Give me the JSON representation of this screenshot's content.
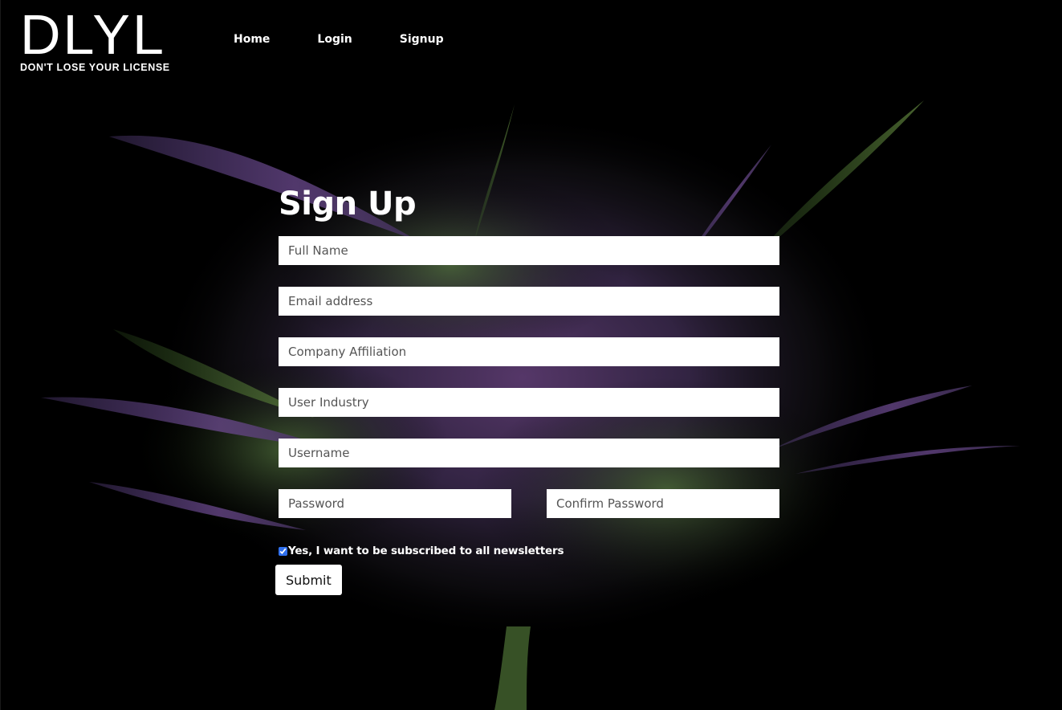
{
  "brand": {
    "logo_text": "DLYL",
    "tagline": "DON'T LOSE YOUR LICENSE"
  },
  "nav": {
    "items": [
      {
        "label": "Home"
      },
      {
        "label": "Login"
      },
      {
        "label": "Signup"
      }
    ]
  },
  "form": {
    "title": "Sign Up",
    "full_name_placeholder": "Full Name",
    "email_placeholder": "Email address",
    "company_placeholder": "Company Affiliation",
    "industry_placeholder": "User Industry",
    "username_placeholder": "Username",
    "password_placeholder": "Password",
    "confirm_password_placeholder": "Confirm Password",
    "newsletter_label": "Yes, I want to be subscribed to all newsletters",
    "newsletter_checked": true,
    "submit_label": "Submit"
  },
  "colors": {
    "background": "#000000",
    "field_background": "#ffffff",
    "checkbox_accent": "#2f6fed"
  }
}
